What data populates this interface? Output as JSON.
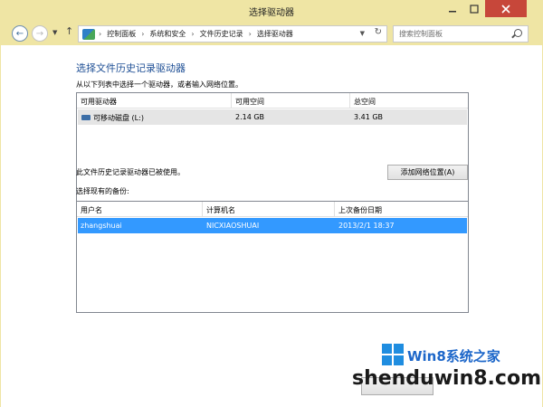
{
  "window": {
    "title": "选择驱动器"
  },
  "nav": {
    "breadcrumbs": [
      "控制面板",
      "系统和安全",
      "文件历史记录",
      "选择驱动器"
    ],
    "search_placeholder": "搜索控制面板"
  },
  "main": {
    "heading": "选择文件历史记录驱动器",
    "instruction": "从以下列表中选择一个驱动器，或者输入网络位置。",
    "drives": {
      "columns": [
        "可用驱动器",
        "可用空间",
        "总空间"
      ],
      "rows": [
        {
          "name": "可移动磁盘 (L:)",
          "free": "2.14 GB",
          "total": "3.41 GB",
          "icon": "removable-drive-icon"
        }
      ]
    },
    "status_text": "此文件历史记录驱动器已被使用。",
    "add_network_label": "添加网络位置(A)",
    "existing_label": "选择现有的备份:",
    "backups": {
      "columns": [
        "用户名",
        "计算机名",
        "上次备份日期"
      ],
      "rows": [
        {
          "user": "zhangshuai",
          "computer": "NICXIAOSHUAI",
          "date": "2013/2/1 18:37",
          "selected": true
        }
      ]
    }
  },
  "watermark": {
    "brand": "Win8系统之家",
    "url": "shenduwin8.com"
  },
  "colors": {
    "frame": "#efe5a4",
    "heading": "#1e4f95",
    "selection": "#3399ff",
    "close": "#c7473a"
  }
}
